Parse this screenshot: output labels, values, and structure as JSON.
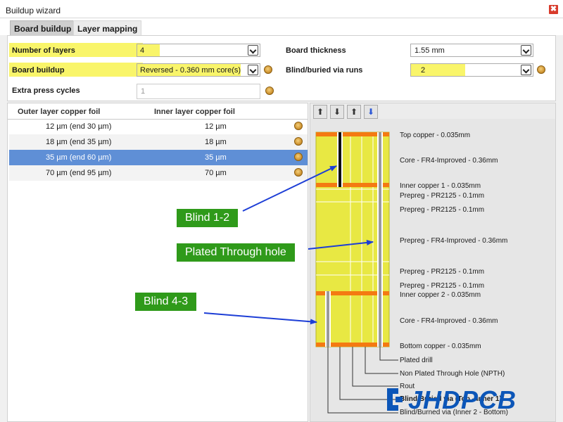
{
  "window": {
    "title": "Buildup wizard",
    "close_label": "✖"
  },
  "tabs": [
    {
      "label": "Board buildup",
      "active": true
    },
    {
      "label": "Layer mapping",
      "active": false
    }
  ],
  "form": {
    "number_of_layers": {
      "label": "Number of layers",
      "value": "4"
    },
    "board_buildup": {
      "label": "Board buildup",
      "value": "Reversed - 0.360 mm core(s)"
    },
    "extra_press_cycles": {
      "label": "Extra press cycles",
      "value": "1"
    },
    "board_thickness": {
      "label": "Board thickness",
      "value": "1.55 mm"
    },
    "blind_buried_via_runs": {
      "label": "Blind/buried via runs",
      "value": "2"
    }
  },
  "copper_table": {
    "columns": [
      "Outer layer copper foil",
      "Inner layer copper foil"
    ],
    "rows": [
      {
        "outer": "12 µm (end 30 µm)",
        "inner": "12 µm",
        "selected": false
      },
      {
        "outer": "18 µm (end 35 µm)",
        "inner": "18 µm",
        "selected": false
      },
      {
        "outer": "35 µm (end 60 µm)",
        "inner": "35 µm",
        "selected": true
      },
      {
        "outer": "70 µm (end 95 µm)",
        "inner": "70 µm",
        "selected": false
      }
    ]
  },
  "toolbar": [
    {
      "icon": "move-up-icon",
      "glyph": "⬆"
    },
    {
      "icon": "move-down-icon",
      "glyph": "⬇"
    },
    {
      "icon": "insert-up-icon",
      "glyph": "⬆"
    },
    {
      "icon": "insert-down-icon",
      "glyph": "⬇"
    }
  ],
  "stack_layers": [
    "Top copper - 0.035mm",
    "Core - FR4-Improved - 0.36mm",
    "Inner copper 1 - 0.035mm",
    "Prepreg - PR2125 - 0.1mm",
    "Prepreg - PR2125 - 0.1mm",
    "Prepreg - FR4-Improved - 0.36mm",
    "Prepreg - PR2125 - 0.1mm",
    "Prepreg - PR2125 - 0.1mm",
    "Inner copper 2 - 0.035mm",
    "Core - FR4-Improved - 0.36mm",
    "Bottom copper - 0.035mm"
  ],
  "drill_legend": [
    "Plated drill",
    "Non Plated Through Hole (NPTH)",
    "Rout",
    "Blind/Buried via (Top - Inner 1)",
    "Blind/Burned via (Inner 2 - Bottom)"
  ],
  "callouts": {
    "blind_1_2": "Blind 1-2",
    "plated_through_hole": "Plated Through hole",
    "blind_4_3": "Blind 4-3"
  },
  "watermark": {
    "text": "JHDPCB"
  },
  "colors": {
    "highlight": "#f9f56a",
    "selected_row": "#5f8fd6",
    "dielectric": "#e8e843",
    "copper": "#f47a12",
    "callout": "#2f9a1a",
    "arrow": "#1d3ed6",
    "watermark": "#0c56b8"
  }
}
